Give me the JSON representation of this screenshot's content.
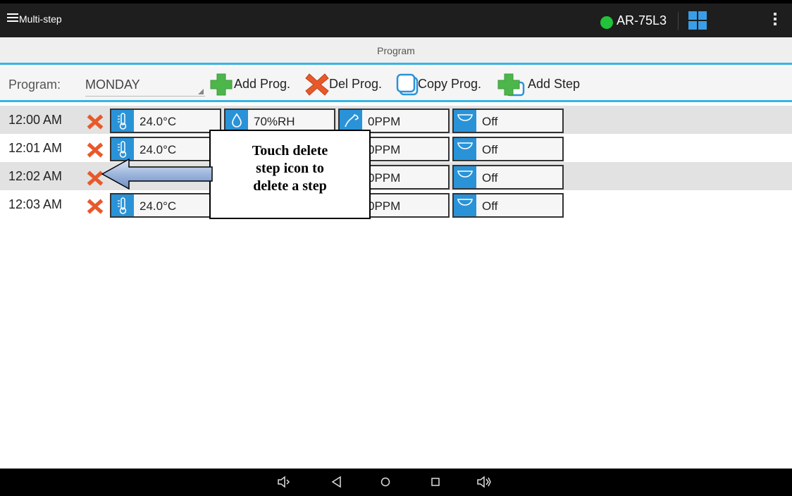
{
  "appbar": {
    "title": "Multi-step",
    "device": "AR-75L3",
    "status_color": "#22c23a"
  },
  "section": {
    "title": "Program"
  },
  "program": {
    "label": "Program:",
    "selected": "MONDAY",
    "buttons": {
      "add_prog": "Add Prog.",
      "del_prog": "Del Prog.",
      "copy_prog": "Copy Prog.",
      "add_step": "Add Step"
    }
  },
  "steps": [
    {
      "time": "12:00 AM",
      "temperature": "24.0°C",
      "humidity": "70%RH",
      "co2": "0PPM",
      "light": "Off"
    },
    {
      "time": "12:01 AM",
      "temperature": "24.0°C",
      "co2": "0PPM",
      "light": "Off"
    },
    {
      "time": "12:02 AM",
      "co2": "0PPM",
      "light": "Off"
    },
    {
      "time": "12:03 AM",
      "temperature": "24.0°C",
      "co2": "0PPM",
      "light": "Off"
    }
  ],
  "callout": {
    "line1": "Touch delete",
    "line2": "step icon to",
    "line3": "delete a step"
  },
  "icons": {
    "menu": "hamburger-icon",
    "status": "status-dot-icon",
    "grid": "grid-icon",
    "overflow": "overflow-icon",
    "add": "plus-icon",
    "delete": "x-icon",
    "copy": "copy-icon",
    "temperature": "thermometer-icon",
    "humidity": "water-drop-icon",
    "co2": "co2-icon",
    "light": "lamp-icon",
    "nav": [
      "volume-down-icon",
      "back-icon",
      "home-icon",
      "recents-icon",
      "volume-up-icon"
    ]
  },
  "colors": {
    "accent": "#33b5e5",
    "icon_bg": "#2a93d8",
    "delete": "#e8592a",
    "add": "#4db64b"
  }
}
